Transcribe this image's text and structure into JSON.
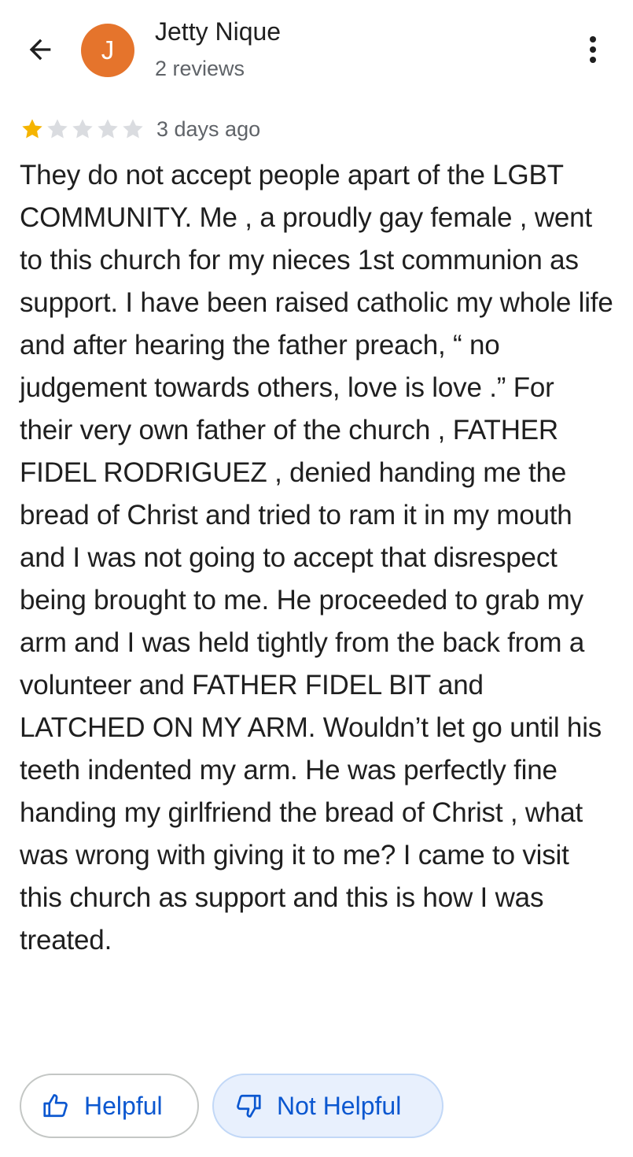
{
  "header": {
    "back_icon": "arrow-left-icon",
    "avatar_initial": "J",
    "avatar_color": "#e5742c",
    "author_name": "Jetty Nique",
    "review_count": "2 reviews",
    "more_icon": "more-vert-icon"
  },
  "review": {
    "rating": 1,
    "rating_max": 5,
    "star_filled_color": "#f5b400",
    "star_empty_color": "#dadce0",
    "time_ago": "3 days ago",
    "text": "They do not accept people apart of the LGBT COMMUNITY. Me , a proudly gay female , went to this church for my nieces 1st communion as support. I have been raised catholic my whole life and after hearing the father preach, “ no judgement towards others, love is love .” For their very own father of the church , FATHER FIDEL RODRIGUEZ , denied handing me the bread of Christ and tried to ram it in my mouth and I was not going to accept that disrespect being brought to me. He proceeded to grab my arm and I was held tightly from the back from a volunteer and FATHER FIDEL BIT and LATCHED ON MY ARM. Wouldn’t let go until his teeth indented my arm. He was perfectly fine handing my girlfriend the bread of Christ , what was wrong with giving it to me? I came to visit this church as support and this is how I was treated."
  },
  "actions": {
    "helpful_label": "Helpful",
    "helpful_icon": "thumb-up-icon",
    "not_helpful_label": "Not Helpful",
    "not_helpful_icon": "thumb-down-icon",
    "accent_color": "#0b57d0"
  }
}
